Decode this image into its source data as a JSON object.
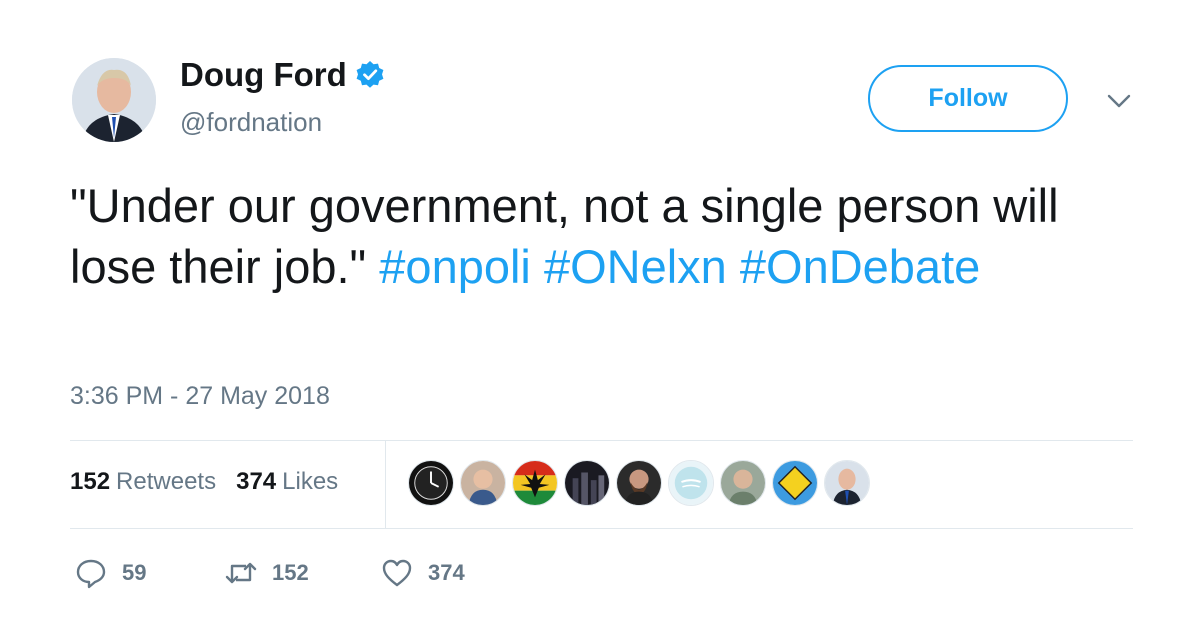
{
  "user": {
    "name": "Doug Ford",
    "handle": "@fordnation",
    "verified": true
  },
  "follow_button": "Follow",
  "tweet": {
    "text_plain": "\"Under our government, not a single person will lose their job.\" ",
    "hashtags": [
      "#onpoli",
      "#ONelxn",
      "#OnDebate"
    ],
    "timestamp": "3:36 PM - 27 May 2018"
  },
  "stats": {
    "retweets_count": "152",
    "retweets_label": "Retweets",
    "likes_count": "374",
    "likes_label": "Likes"
  },
  "actions": {
    "reply_count": "59",
    "retweet_count": "152",
    "like_count": "374"
  },
  "colors": {
    "accent": "#1da1f2",
    "muted": "#657786",
    "text": "#14171a",
    "divider": "#e1e8ed"
  }
}
